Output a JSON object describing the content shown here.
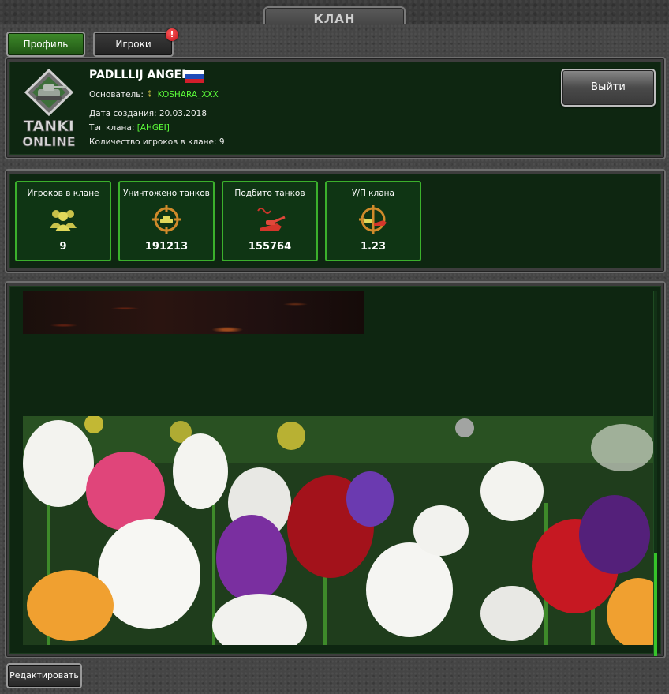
{
  "window": {
    "title": "КЛАН"
  },
  "tabs": [
    {
      "label": "Профиль",
      "active": true
    },
    {
      "label": "Игроки",
      "active": false
    }
  ],
  "players_tab_badge": "!",
  "clan": {
    "name": "PADLLLIJ ANGEL",
    "flag": "russia",
    "founder_label": "Основатель:",
    "founder_name": "KOSHARA_XXX",
    "created_label": "Дата создания:",
    "created_date": "20.03.2018",
    "tag_label": "Тэг клана:",
    "tag_value": "[AHGEI]",
    "players_count_label": "Количество игроков в клане:",
    "players_count": "9"
  },
  "logo": {
    "line1": "TANKI",
    "line2": "ONLINE"
  },
  "exit_button": {
    "label": "Выйти"
  },
  "stats": [
    {
      "label": "Игроков в клане",
      "value": "9",
      "icon": "players-icon"
    },
    {
      "label": "Уничтожено танков",
      "value": "191213",
      "icon": "destroyed-tank-icon"
    },
    {
      "label": "Подбито танков",
      "value": "155764",
      "icon": "hit-tank-icon"
    },
    {
      "label": "У/П клана",
      "value": "1.23",
      "icon": "kill-death-ratio-icon"
    }
  ],
  "edit_button": {
    "label": "Редактировать"
  },
  "colors": {
    "accent_green": "#3bb02c",
    "panel_green": "#0e2611",
    "highlight_green": "#5cff3a"
  }
}
